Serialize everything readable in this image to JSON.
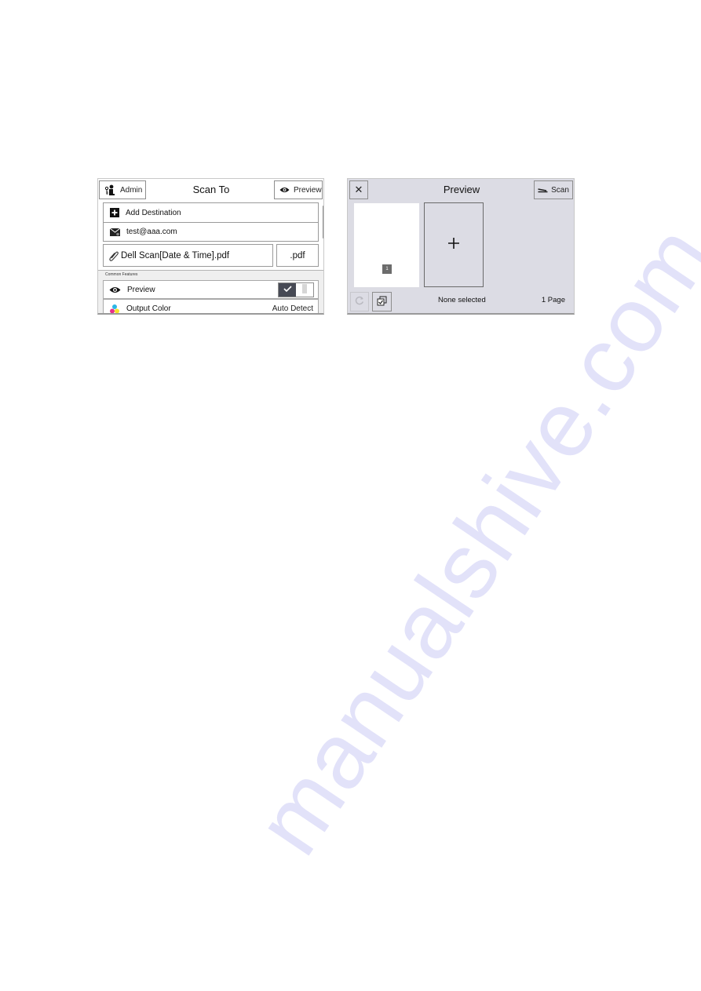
{
  "scan_to_screen": {
    "title": "Scan To",
    "admin_button": {
      "label": "Admin",
      "icon": "admin-user-icon"
    },
    "preview_button": {
      "label": "Preview",
      "icon": "eye-icon"
    },
    "destinations": [
      {
        "label": "Add Destination",
        "icon": "plus-icon"
      },
      {
        "label": "test@aaa.com",
        "icon": "envelope-icon"
      }
    ],
    "file_name": {
      "value": "Dell Scan[Date & Time].pdf",
      "icon": "paperclip-icon"
    },
    "file_type": {
      "value": ".pdf"
    },
    "section_label": "Common Features",
    "features": [
      {
        "label": "Preview",
        "icon": "eye-icon",
        "toggle_on": true
      },
      {
        "label": "Output Color",
        "icon": "color-dots-icon",
        "value": "Auto Detect"
      }
    ]
  },
  "preview_screen": {
    "title": "Preview",
    "close_button": {
      "label": "✕",
      "icon": "close-icon"
    },
    "scan_button": {
      "label": "Scan",
      "icon": "scan-icon"
    },
    "pages": [
      {
        "number": "1"
      }
    ],
    "add_page": {
      "label": "+"
    },
    "selection_status": "None selected",
    "page_count": "1 Page"
  },
  "watermark": "manualshive.com"
}
